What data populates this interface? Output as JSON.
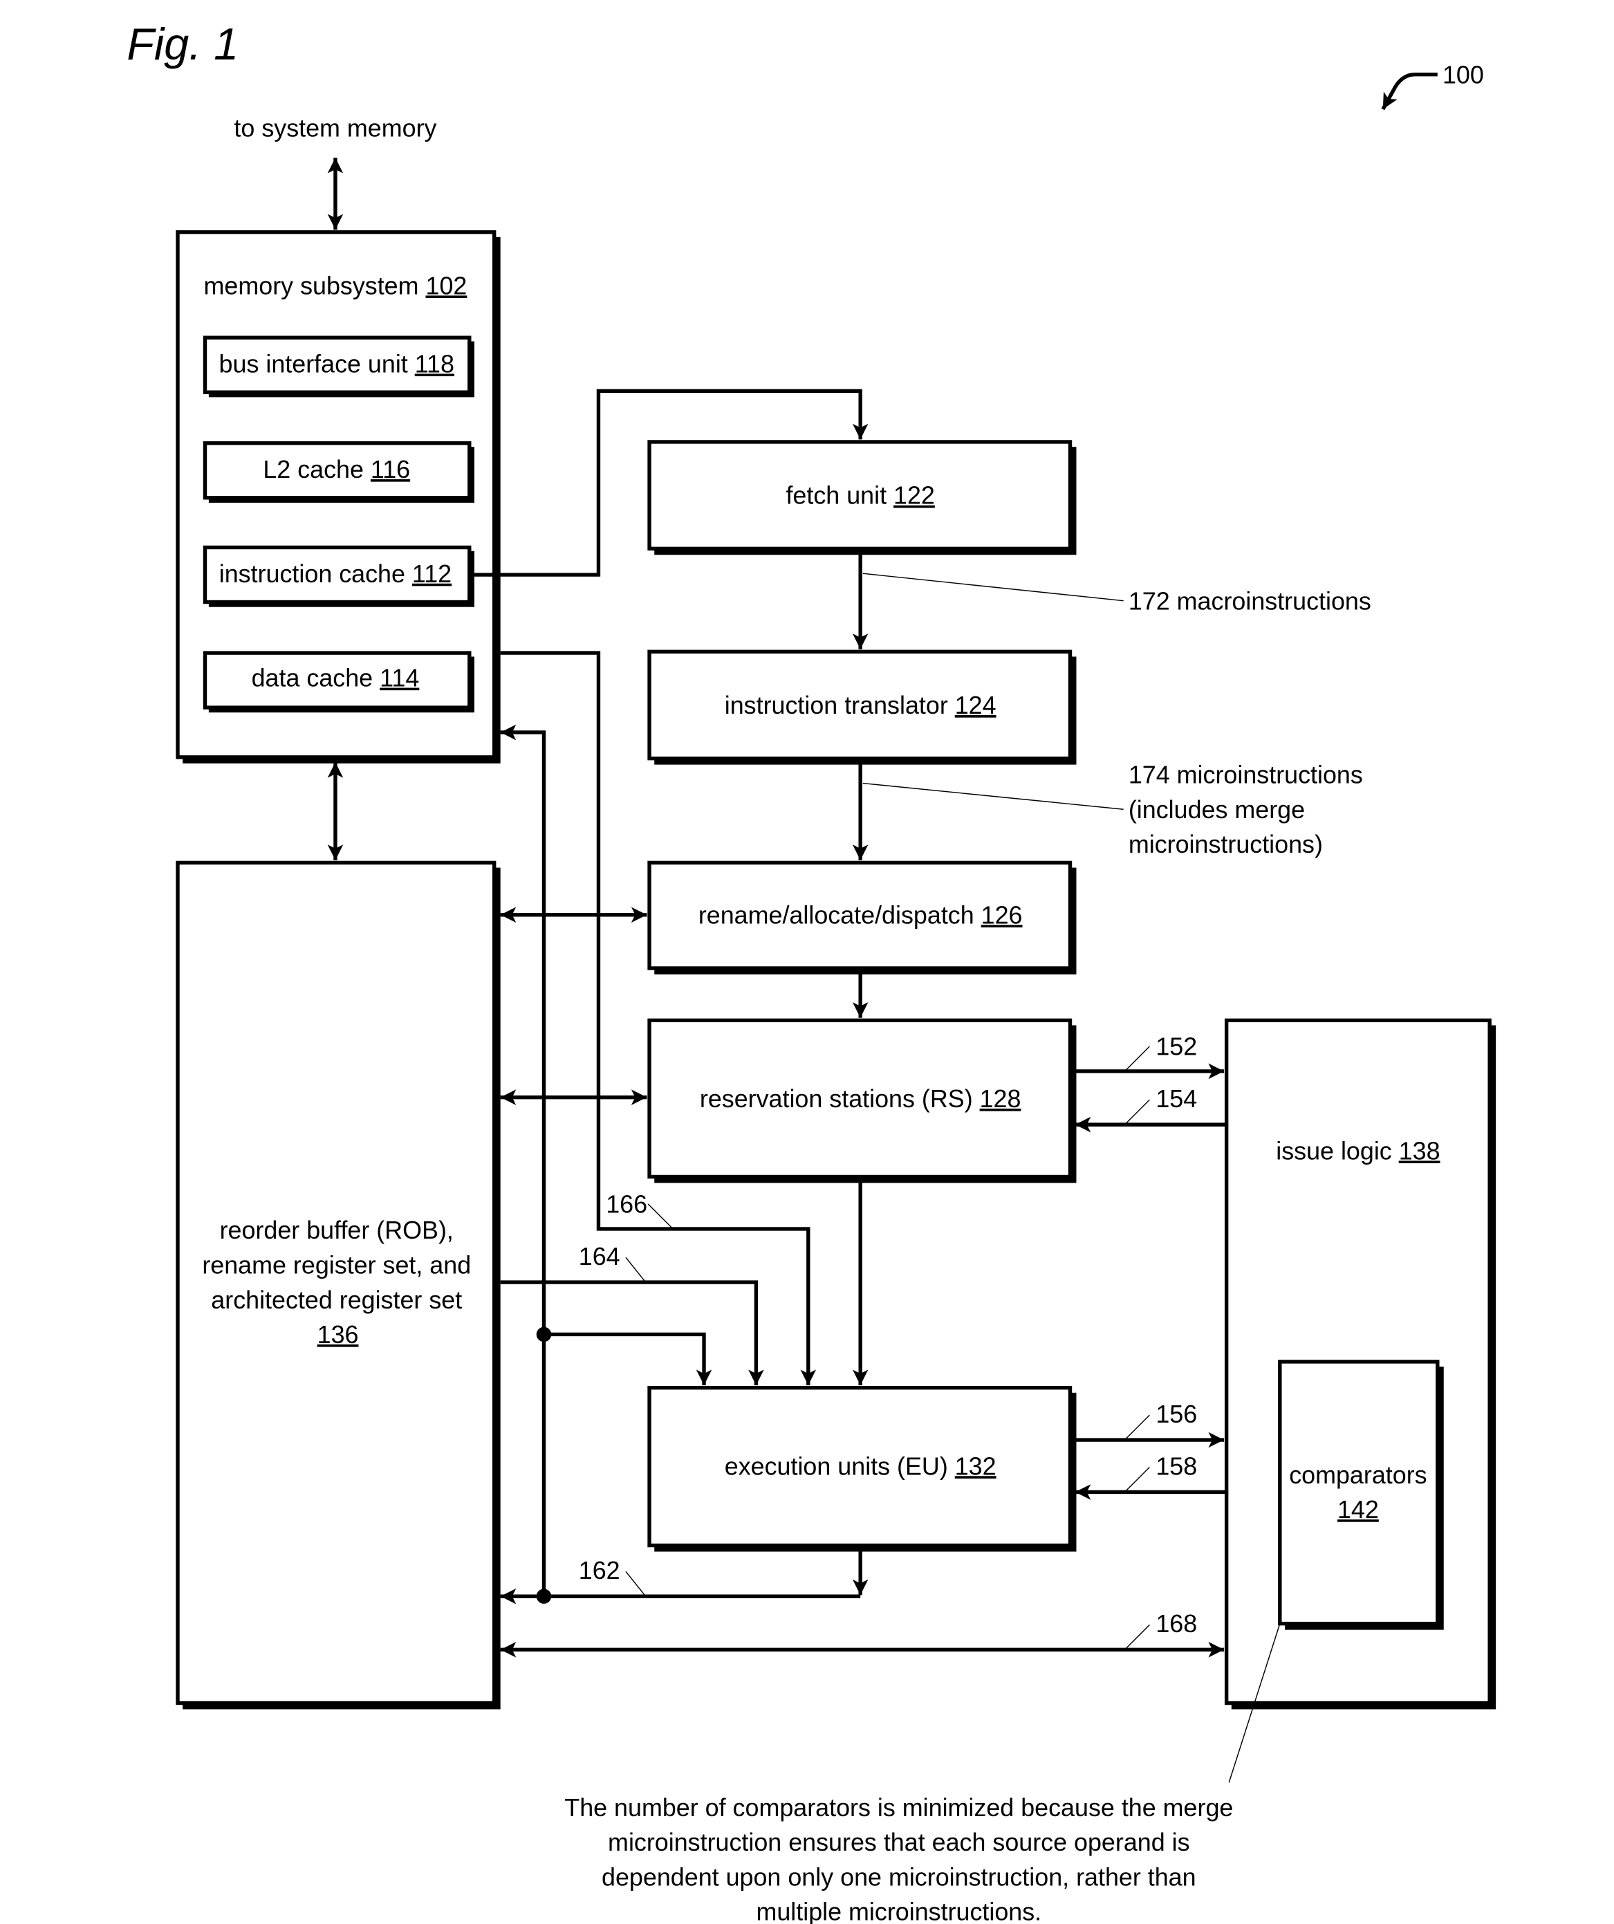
{
  "figure": {
    "title": "Fig. 1",
    "ref_number": "100"
  },
  "colors": {
    "ink": "#000000",
    "background": "#ffffff"
  },
  "external": {
    "system_memory_label": "to system memory"
  },
  "blocks": {
    "memory_subsystem": {
      "label": "memory subsystem",
      "ref": "102"
    },
    "bus_interface_unit": {
      "label": "bus interface unit",
      "ref": "118"
    },
    "l2_cache": {
      "label": "L2 cache",
      "ref": "116"
    },
    "instruction_cache": {
      "label": "instruction cache",
      "ref": "112"
    },
    "data_cache": {
      "label": "data cache",
      "ref": "114"
    },
    "fetch_unit": {
      "label": "fetch unit",
      "ref": "122"
    },
    "instruction_translator": {
      "label": "instruction translator",
      "ref": "124"
    },
    "rename_dispatch": {
      "label": "rename/allocate/dispatch",
      "ref": "126"
    },
    "reservation_stations": {
      "label": "reservation stations (RS)",
      "ref": "128"
    },
    "execution_units": {
      "label": "execution units (EU)",
      "ref": "132"
    },
    "rob": {
      "lines": [
        "reorder buffer (ROB),",
        "rename register set, and",
        "architected register set"
      ],
      "ref": "136"
    },
    "issue_logic": {
      "label": "issue logic",
      "ref": "138"
    },
    "comparators": {
      "label": "comparators",
      "ref": "142"
    }
  },
  "signals": {
    "s172": {
      "lines": [
        "172 macroinstructions"
      ]
    },
    "s174": {
      "lines": [
        "174 microinstructions",
        "(includes merge",
        "microinstructions)"
      ]
    },
    "s152": "152",
    "s154": "154",
    "s156": "156",
    "s158": "158",
    "s162": "162",
    "s164": "164",
    "s166": "166",
    "s168": "168"
  },
  "caption": {
    "lines": [
      "The number of comparators is minimized because the merge",
      "microinstruction ensures that each source operand is",
      "dependent upon only one microinstruction, rather than",
      "multiple microinstructions."
    ]
  }
}
